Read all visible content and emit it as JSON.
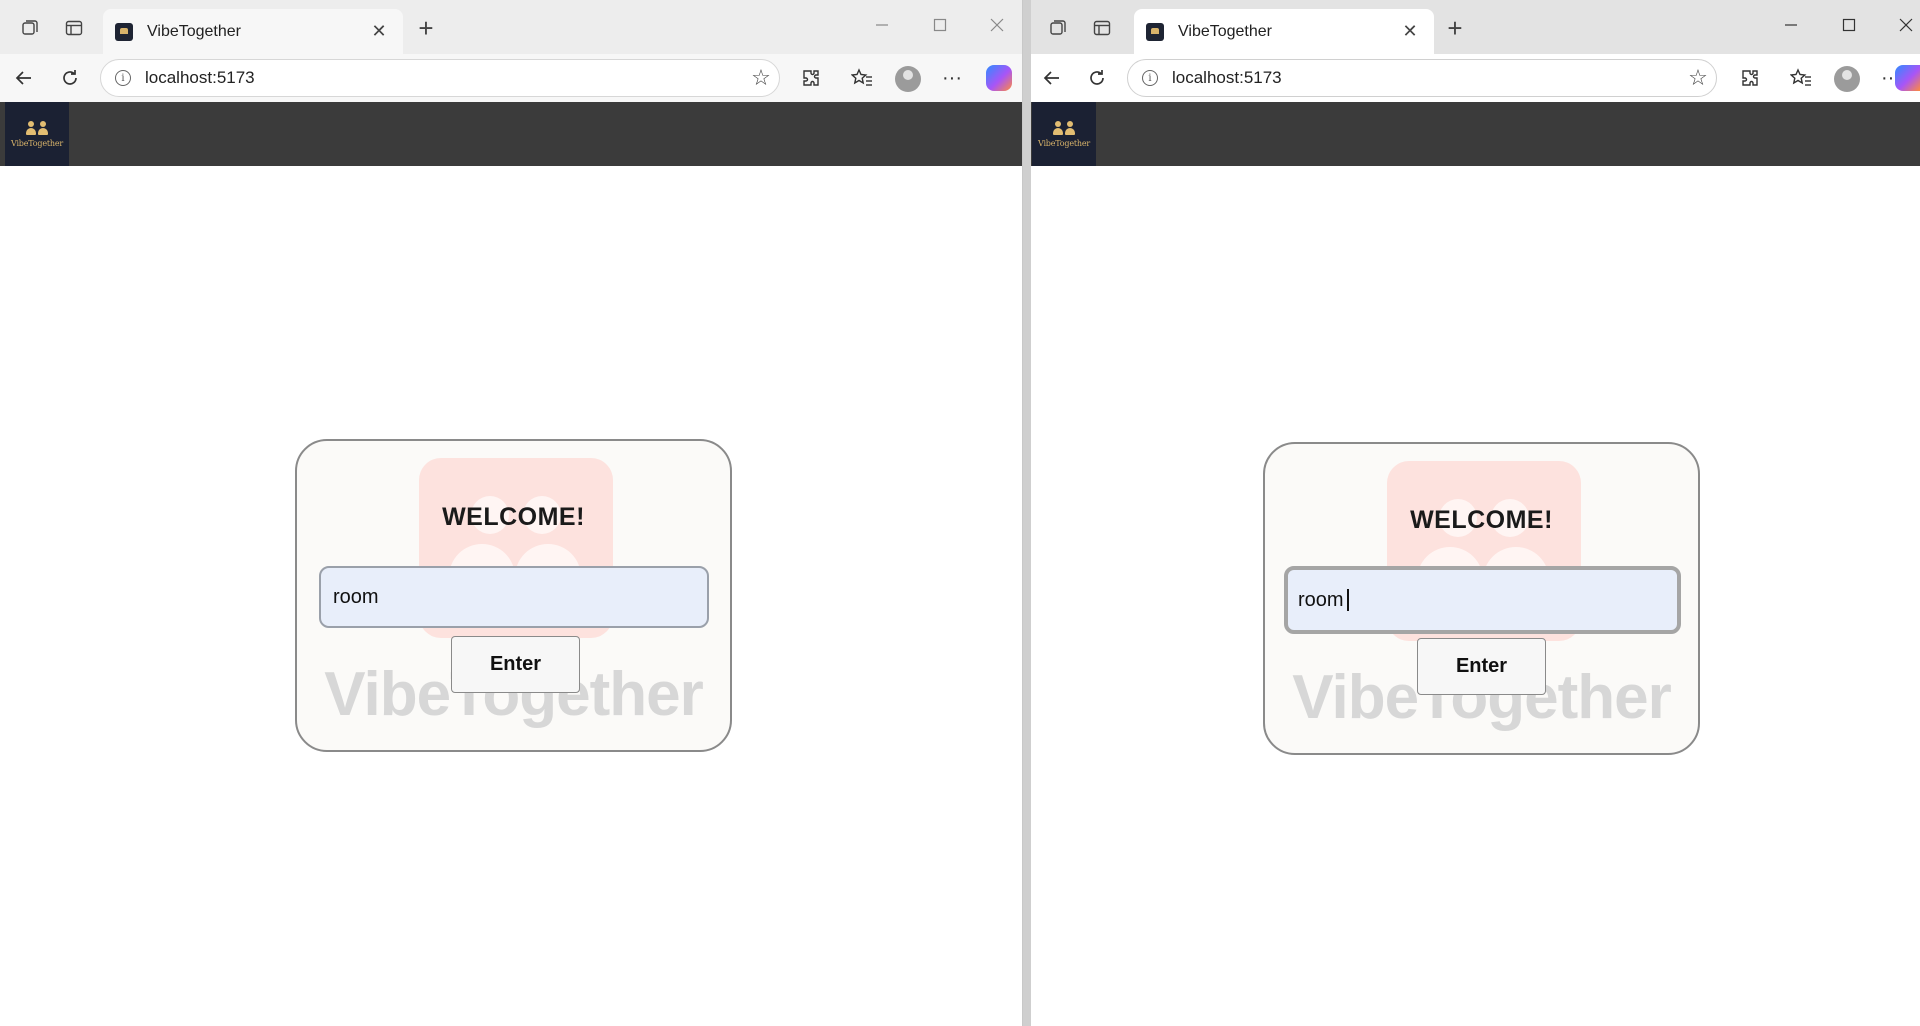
{
  "windows": [
    {
      "id": "left",
      "tab": {
        "title": "VibeTogether"
      },
      "address": {
        "url": "localhost:5173"
      },
      "app": {
        "logo_text": "VibeTogether",
        "card": {
          "welcome": "WELCOME!",
          "room_value": "room",
          "enter_label": "Enter",
          "watermark": "VibeTogether"
        }
      }
    },
    {
      "id": "right",
      "tab": {
        "title": "VibeTogether"
      },
      "address": {
        "url": "localhost:5173"
      },
      "app": {
        "logo_text": "VibeTogether",
        "card": {
          "welcome": "WELCOME!",
          "room_value": "room",
          "enter_label": "Enter",
          "watermark": "VibeTogether"
        }
      }
    }
  ],
  "colors": {
    "navbar": "#3b3b3b",
    "logo_bg": "#1b2133",
    "logo_gold": "#d8b36a",
    "input_bg": "#e8eefa",
    "watermark_box": "#fde2de"
  },
  "icons": {
    "tab_actions": "tab-actions-icon",
    "vertical_tabs": "vertical-tabs-icon",
    "back": "back-arrow-icon",
    "refresh": "refresh-icon",
    "info": "info-icon",
    "favorite": "star-icon",
    "extensions": "puzzle-icon",
    "favorites": "favorites-icon",
    "profile": "profile-avatar-icon",
    "more": "more-icon",
    "copilot": "copilot-icon"
  }
}
